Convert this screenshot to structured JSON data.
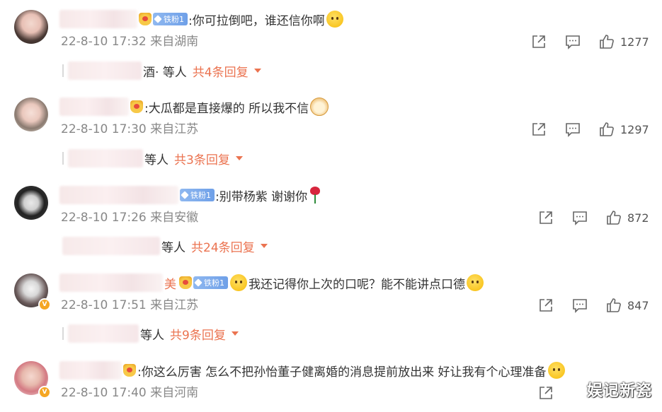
{
  "watermark": "娱记新瓷",
  "colors": {
    "accent": "#eb7350",
    "meta": "#888888",
    "fan_badge": "#7aa8ec",
    "crown": "#f5b731"
  },
  "comments": [
    {
      "name": "",
      "badges": [
        "crown",
        "铁粉1"
      ],
      "text": ":你可拉倒吧，谁还信你啊",
      "emoji_after": "sweat-smile-emoji",
      "time": "22-8-10 17:32",
      "location": "来自湖南",
      "likes": "1277",
      "reply_from": "酒· 等人",
      "reply_count": "共4条回复",
      "verified": false
    },
    {
      "name": "",
      "badges": [
        "crown"
      ],
      "text": ":大瓜都是直接爆的 所以我不信",
      "emoji_after": "dog-emoji",
      "time": "22-8-10 17:30",
      "location": "来自江苏",
      "likes": "1297",
      "reply_from": "等人",
      "reply_count": "共3条回复",
      "verified": false
    },
    {
      "name": "",
      "badges": [
        "铁粉1"
      ],
      "text": ":别带杨紫 谢谢你",
      "emoji_after": "rose-emoji",
      "time": "22-8-10 17:26",
      "location": "来自安徽",
      "likes": "872",
      "reply_from": "等人",
      "reply_count": "共24条回复",
      "verified": false
    },
    {
      "name": "美",
      "badges": [
        "crown",
        "铁粉1"
      ],
      "emoji_before": "shy-emoji",
      "text": "我还记得你上次的口呢？能不能讲点口德",
      "emoji_after": "thinking-emoji",
      "time": "22-8-10 17:51",
      "location": "来自江苏",
      "likes": "847",
      "reply_from": "等人",
      "reply_count": "共9条回复",
      "verified": true
    },
    {
      "name": "",
      "badges": [
        "crown"
      ],
      "text": ":你这么厉害 怎么不把孙怡董子健离婚的消息提前放出来 好让我有个心理准备",
      "emoji_after": "question-emoji",
      "time": "22-8-10 17:40",
      "location": "来自河南",
      "likes": "",
      "verified": true
    }
  ]
}
